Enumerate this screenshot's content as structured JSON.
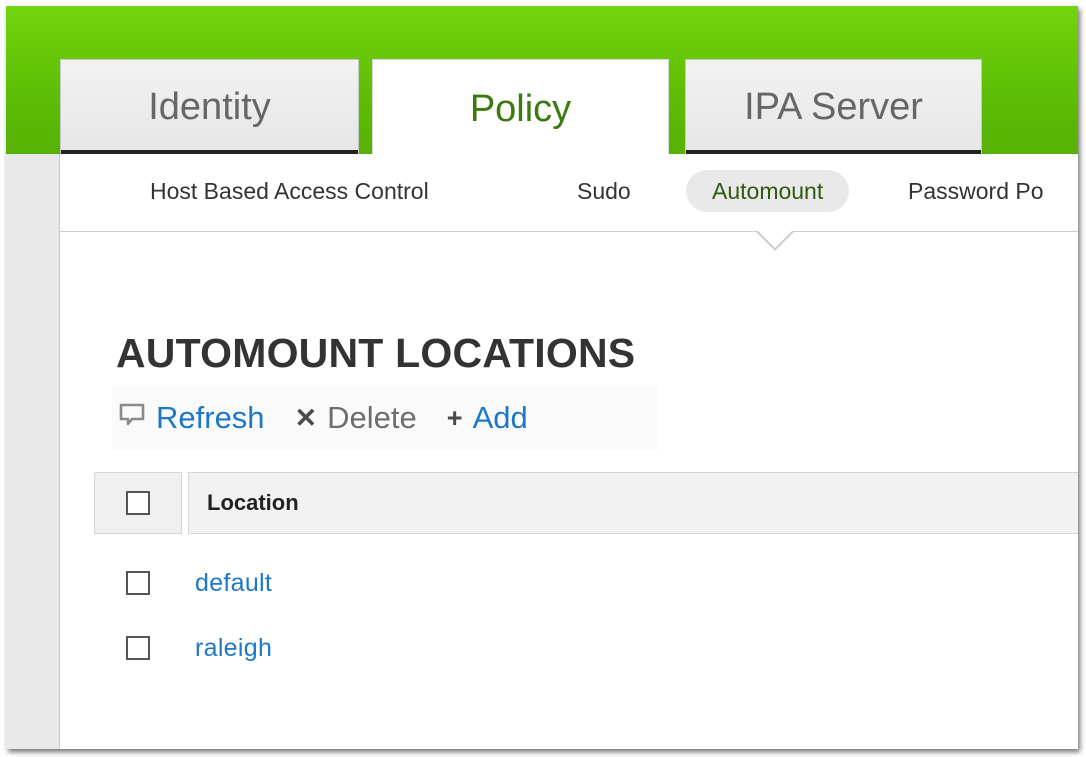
{
  "colors": {
    "brand_green": "#5fbf06",
    "active_tab_text": "#3a7a10",
    "link_blue": "#1e78c8"
  },
  "top_tabs": [
    {
      "label": "Identity",
      "active": false
    },
    {
      "label": "Policy",
      "active": true
    },
    {
      "label": "IPA Server",
      "active": false
    }
  ],
  "sub_nav": [
    {
      "label": "Host Based Access Control",
      "active": false
    },
    {
      "label": "Sudo",
      "active": false
    },
    {
      "label": "Automount",
      "active": true
    },
    {
      "label": "Password Po",
      "active": false
    }
  ],
  "page": {
    "title": "AUTOMOUNT LOCATIONS"
  },
  "toolbar": {
    "refresh": {
      "label": "Refresh",
      "icon": "refresh-icon"
    },
    "delete": {
      "label": "Delete",
      "icon": "close-icon"
    },
    "add": {
      "label": "Add",
      "icon": "plus-icon"
    }
  },
  "table": {
    "columns": [
      "Location"
    ],
    "rows": [
      {
        "location": "default",
        "checked": false
      },
      {
        "location": "raleigh",
        "checked": false
      }
    ]
  }
}
